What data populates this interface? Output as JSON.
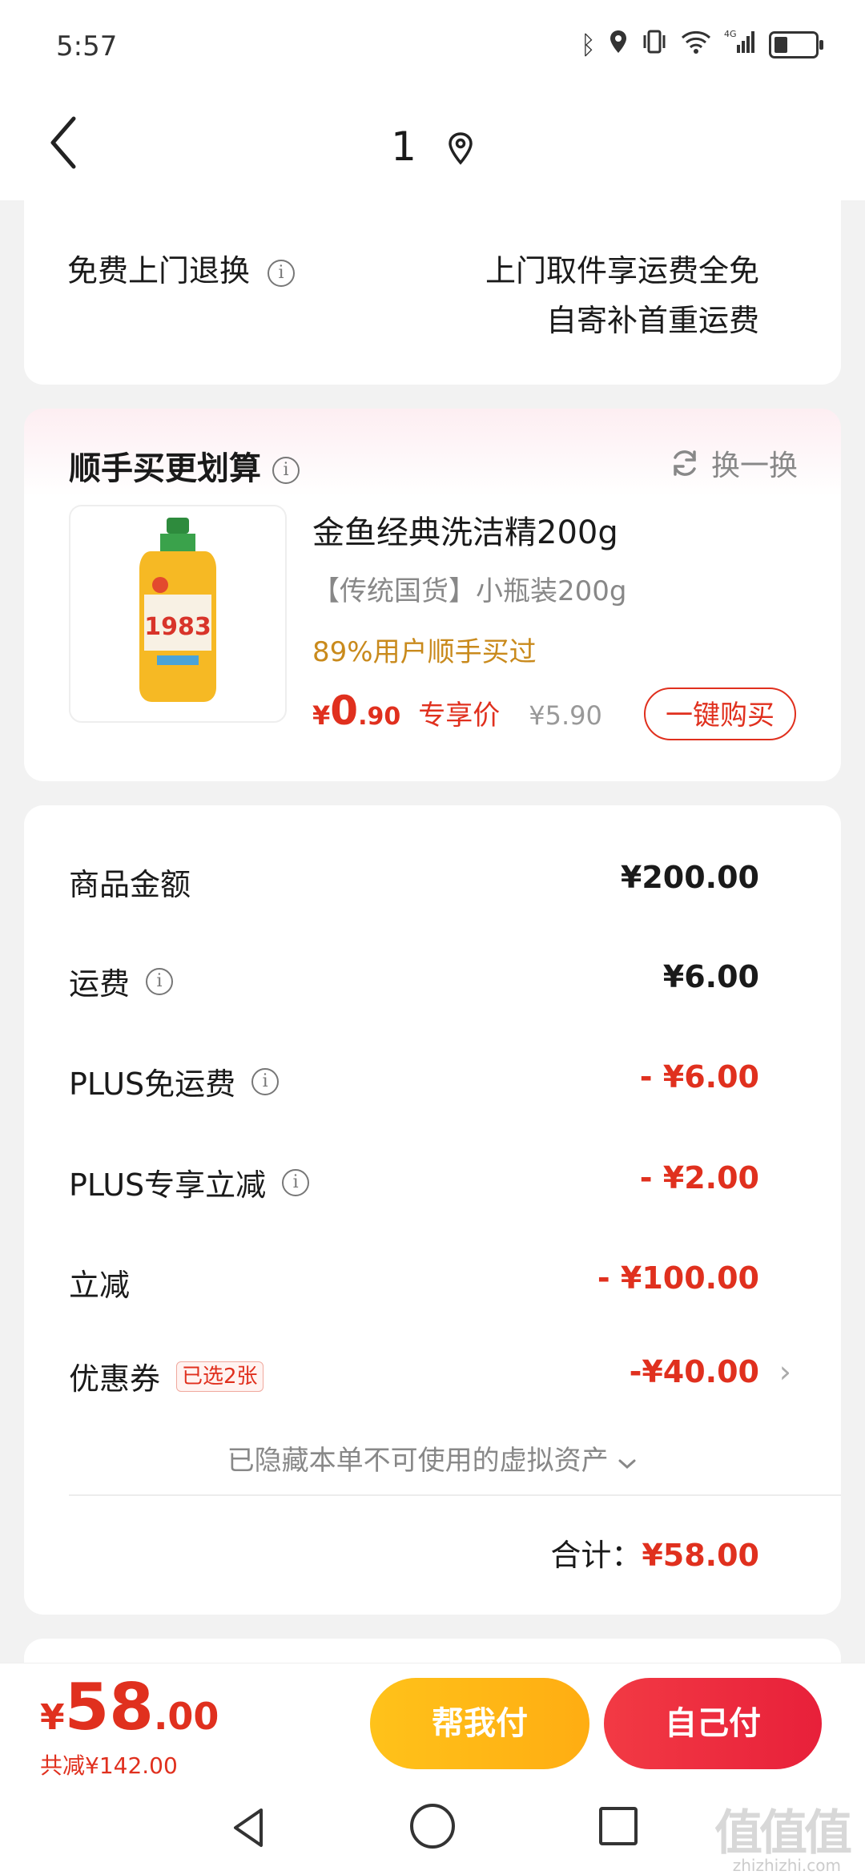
{
  "status_bar": {
    "time": "5:57",
    "network": "4G"
  },
  "nav": {
    "title": "1"
  },
  "return_info": {
    "label": "免费上门退换",
    "line1": "上门取件享运费全免",
    "line2": "自寄补首重运费"
  },
  "recommendation": {
    "title": "顺手买更划算",
    "refresh_label": "换一换",
    "product": {
      "name": "金鱼经典洗洁精200g",
      "subtitle": "【传统国货】小瓶装200g",
      "hint": "89%用户顺手买过",
      "price_symbol": "¥",
      "price_int": "0",
      "price_dec": ".90",
      "price_tag": "专享价",
      "original_price": "¥5.90",
      "buy_label": "一键购买",
      "image_text": "1983"
    }
  },
  "summary": {
    "rows": [
      {
        "label": "商品金额",
        "value": "¥200.00"
      },
      {
        "label": "运费",
        "value": "¥6.00"
      },
      {
        "label": "PLUS免运费",
        "value": "- ¥6.00"
      },
      {
        "label": "PLUS专享立减",
        "value": "- ¥2.00"
      },
      {
        "label": "立减",
        "value": "- ¥100.00"
      },
      {
        "label": "优惠券",
        "tag": "已选2张",
        "value": "-¥40.00"
      }
    ],
    "hidden_assets": "已隐藏本单不可使用的虚拟资产",
    "total_label": "合计：",
    "total_value": "¥58.00"
  },
  "bottom_bar": {
    "price_symbol": "¥",
    "price_int": "58",
    "price_dec": ".00",
    "saved": "共减¥142.00",
    "help_pay": "帮我付",
    "self_pay": "自己付"
  },
  "watermark": {
    "text": "值值值",
    "sub": "zhizhizhi.com"
  },
  "colors": {
    "accent_red": "#e0301e",
    "gold": "#c98a1c",
    "help_btn": "#ffb817",
    "self_btn": "#ee2d40"
  }
}
